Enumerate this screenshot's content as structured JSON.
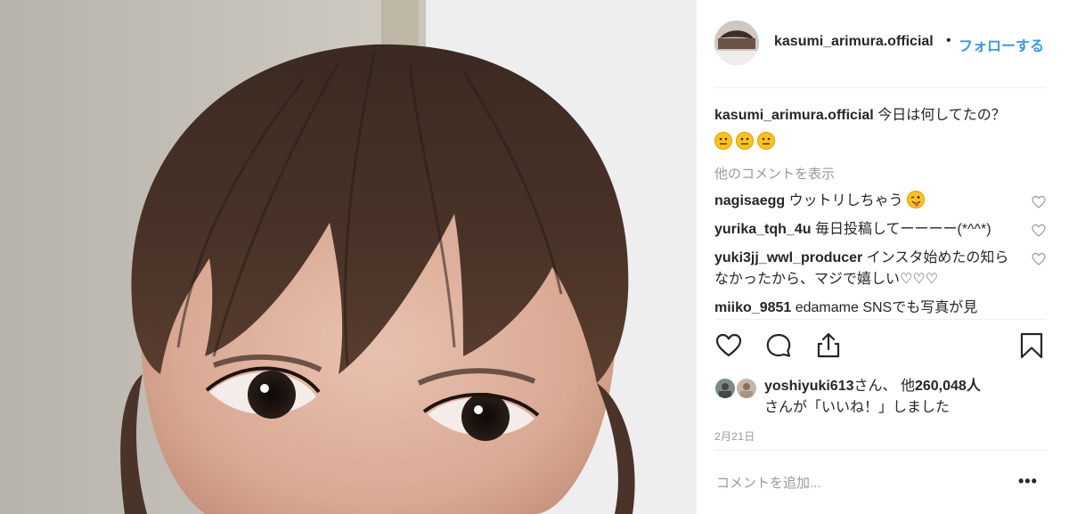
{
  "post": {
    "header": {
      "username": "kasumi_arimura.official",
      "separator": "•",
      "follow_label": "フォローする"
    },
    "caption": {
      "username": "kasumi_arimura.official",
      "text": "今日は何してたの？"
    },
    "load_more_label": "他のコメントを表示",
    "comments": [
      {
        "username": "nagisaegg",
        "text": "ウットリしちゃう"
      },
      {
        "username": "yurika_tqh_4u",
        "text": "毎日投稿してーーーー(*^^*)"
      },
      {
        "username": "yuki3jj_wwl_producer",
        "text": "インスタ始めたの知らなかったから、マジで嬉しい♡♡♡"
      },
      {
        "username": "miiko_9851",
        "text": "edamame SNSでも写真が見"
      }
    ],
    "likes": {
      "username": "yoshiyuki613",
      "suffix1": "さん、",
      "others_prefix": "他",
      "count": "260,048人",
      "suffix2": "さんが「いいね！」しました"
    },
    "date": "2月21日",
    "add_comment_placeholder": "コメントを追加...",
    "more_options": "•••"
  },
  "icons": {
    "like": "heart-outline-icon",
    "comment": "speech-bubble-icon",
    "share": "share-upload-icon",
    "save": "bookmark-icon",
    "comment_like": "small-heart-icon"
  },
  "colors": {
    "text": "#262626",
    "secondary": "#999999",
    "link": "#3897f0",
    "divider": "#efefef"
  }
}
